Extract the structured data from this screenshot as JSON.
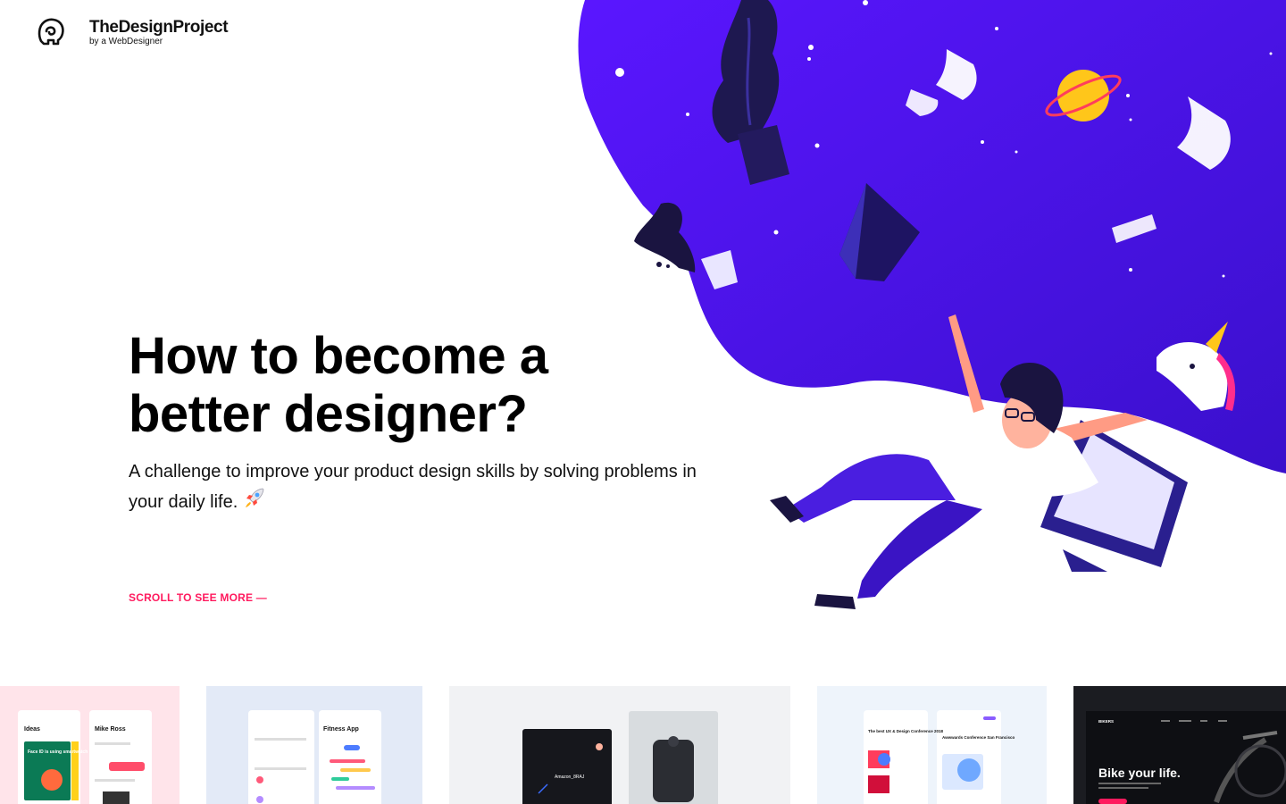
{
  "brand": {
    "name": "TheDesignProject",
    "tagline": "by a WebDesigner"
  },
  "hero": {
    "title": "How to become a better designer?",
    "subtitle": "A challenge to improve your product design skills by solving problems in your daily life.",
    "scroll_cta": "SCROLL TO SEE MORE —",
    "rocket_icon": "rocket-icon"
  },
  "colors": {
    "accent": "#ff1a5e",
    "space_purple": "#4f10f2",
    "space_purple_dark": "#3b0fcf",
    "text": "#000000"
  },
  "thumbnails": [
    {
      "name": "ideas-app",
      "screen_titles": [
        "Ideas",
        "Mike Ross"
      ],
      "card_text": "Face ID is using smartwatch"
    },
    {
      "name": "fitness-app",
      "screen_titles": [
        "Fitness App"
      ]
    },
    {
      "name": "smart-speaker-app",
      "screen_titles": [
        "Amazon_8RAJ"
      ]
    },
    {
      "name": "conference-app",
      "screen_titles": [
        "The best UX & Design Conference 2018",
        "Awwwards Conference San Francisco"
      ]
    },
    {
      "name": "bikes-site",
      "header_label": "BIKERS",
      "headline": "Bike your life."
    }
  ]
}
